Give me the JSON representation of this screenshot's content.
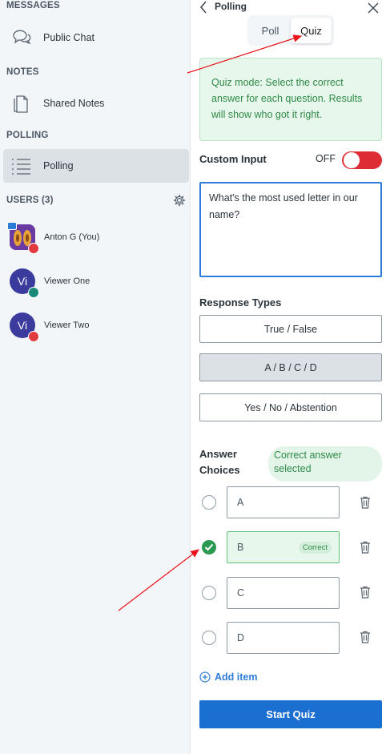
{
  "sidebar": {
    "messages_title": "MESSAGES",
    "public_chat": "Public Chat",
    "notes_title": "NOTES",
    "shared_notes": "Shared Notes",
    "polling_title": "POLLING",
    "polling_item": "Polling",
    "users_title": "USERS (3)",
    "users": [
      {
        "name": "Anton G (You)",
        "initials": ""
      },
      {
        "name": "Viewer One",
        "initials": "Vi"
      },
      {
        "name": "Viewer Two",
        "initials": "Vi"
      }
    ]
  },
  "panel": {
    "title": "Polling",
    "tabs": [
      "Poll",
      "Quiz"
    ],
    "active_tab": "Quiz",
    "info_text": "Quiz mode: Select the correct answer for each question. Results will show who got it right.",
    "custom_input_label": "Custom Input",
    "custom_input_state": "OFF",
    "question_text": "What's the most used letter in our name?",
    "response_types_label": "Response Types",
    "response_types": [
      "True / False",
      "A / B / C / D",
      "Yes / No / Abstention"
    ],
    "selected_response_type": "A / B / C / D",
    "answer_choices_label": "Answer Choices",
    "correct_selected_text": "Correct answer selected",
    "options": [
      {
        "value": "A",
        "correct": false
      },
      {
        "value": "B",
        "correct": true
      },
      {
        "value": "C",
        "correct": false
      },
      {
        "value": "D",
        "correct": false
      }
    ],
    "correct_tag": "Correct",
    "add_item": "Add item",
    "start_button": "Start Quiz"
  },
  "colors": {
    "accent": "#1b6fd1",
    "correct": "#2a9a50",
    "toggle_off": "#de2c34",
    "annotation_arrow": "#e8151b"
  }
}
